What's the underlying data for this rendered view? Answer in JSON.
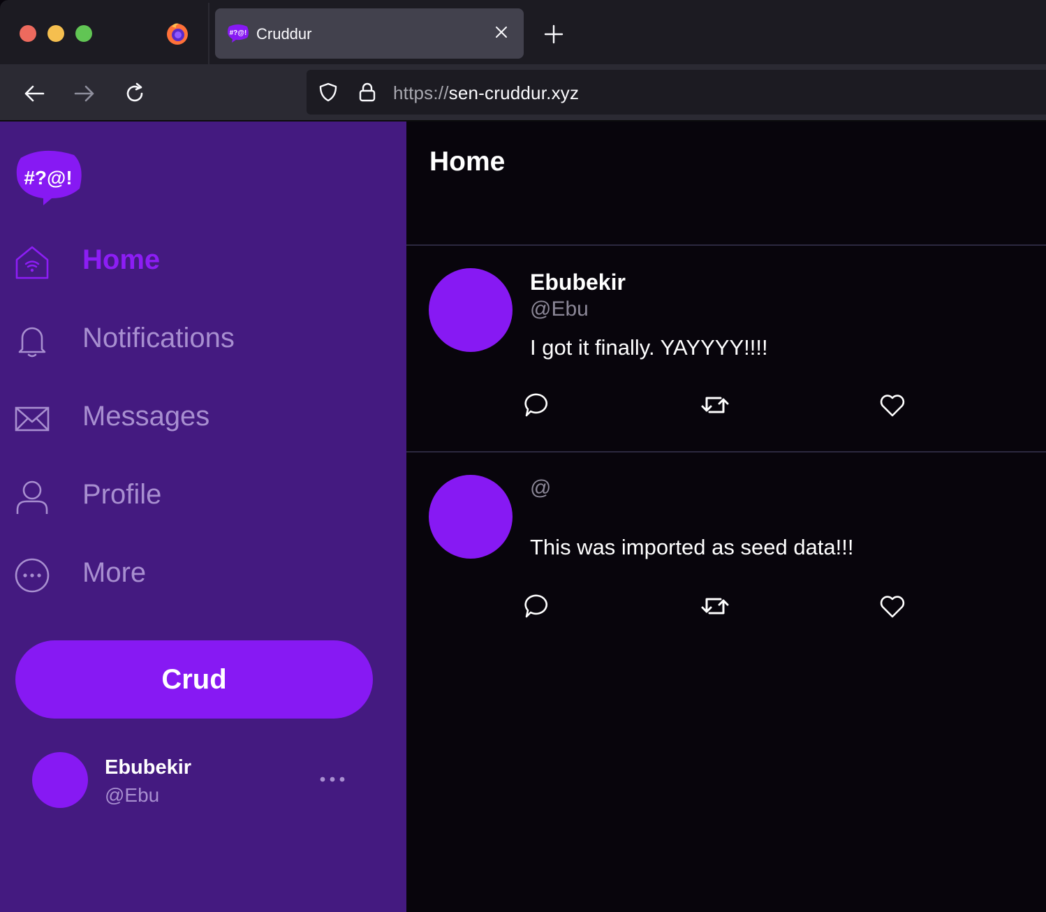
{
  "browser": {
    "tab_title": "Cruddur",
    "favicon_text": "#?@!",
    "url_protocol": "https://",
    "url_host": "sen-cruddur.xyz"
  },
  "sidebar": {
    "logo_text": "#?@!",
    "items": [
      {
        "label": "Home",
        "icon": "home-icon",
        "active": true
      },
      {
        "label": "Notifications",
        "icon": "bell-icon"
      },
      {
        "label": "Messages",
        "icon": "envelope-icon"
      },
      {
        "label": "Profile",
        "icon": "user-icon"
      },
      {
        "label": "More",
        "icon": "more-circle-icon"
      }
    ],
    "crud_label": "Crud",
    "user": {
      "name": "Ebubekir",
      "handle": "@Ebu"
    }
  },
  "main": {
    "title": "Home",
    "posts": [
      {
        "name": "Ebubekir",
        "handle": "@Ebu",
        "text": "I got it finally. YAYYYY!!!!"
      },
      {
        "name": "",
        "handle": "@",
        "text": "This was imported as seed data!!!"
      }
    ]
  },
  "colors": {
    "accent": "#8719f3",
    "sidebar_bg": "#441a80",
    "main_bg": "#08050c"
  }
}
